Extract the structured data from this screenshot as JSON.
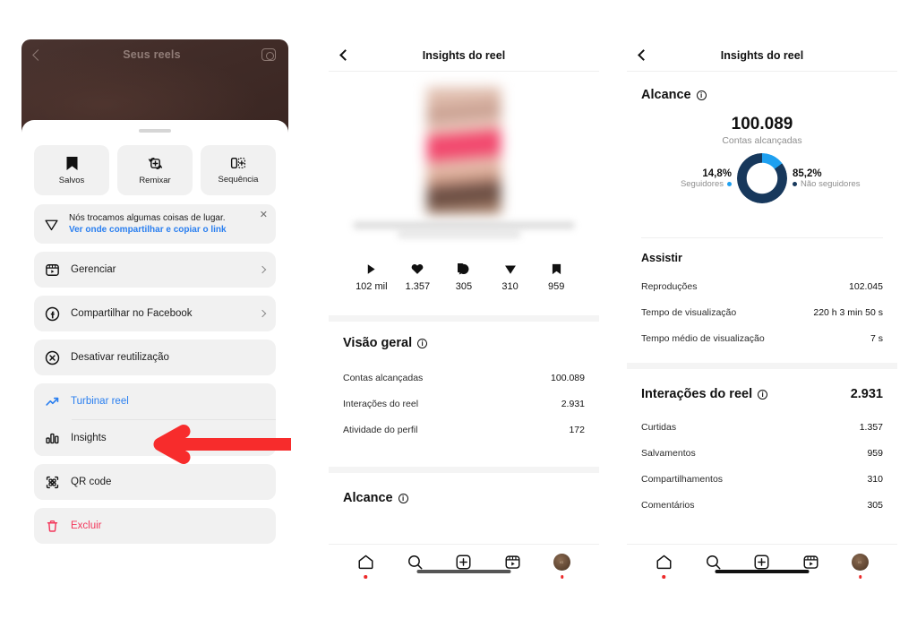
{
  "panel1": {
    "reel_header": {
      "title": "Seus reels",
      "back_icon": "chevron-left-icon",
      "camera_icon": "camera-icon"
    },
    "tiles": [
      {
        "label": "Salvos",
        "icon": "bookmark-icon"
      },
      {
        "label": "Remixar",
        "icon": "remix-icon"
      },
      {
        "label": "Sequência",
        "icon": "sequence-icon"
      }
    ],
    "banner": {
      "icon": "paper-plane-icon",
      "line1": "Nós trocamos algumas coisas de lugar.",
      "line2": "Ver onde compartilhar e copiar o link",
      "close_icon": "close-icon"
    },
    "rows": [
      {
        "label": "Gerenciar",
        "icon": "reels-icon",
        "chevron": true,
        "style": "default"
      },
      {
        "label": "Compartilhar no Facebook",
        "icon": "facebook-icon",
        "chevron": true,
        "style": "default"
      },
      {
        "label": "Desativar reutilização",
        "icon": "circle-x-icon",
        "chevron": false,
        "style": "default"
      }
    ],
    "group_rows": [
      {
        "label": "Turbinar reel",
        "icon": "trending-up-icon",
        "chevron": false,
        "style": "blue"
      },
      {
        "label": "Insights",
        "icon": "bar-chart-icon",
        "chevron": false,
        "style": "default"
      }
    ],
    "rows_after": [
      {
        "label": "QR code",
        "icon": "qr-code-icon",
        "chevron": false,
        "style": "default"
      },
      {
        "label": "Excluir",
        "icon": "trash-icon",
        "chevron": false,
        "style": "red"
      }
    ],
    "annotation": {
      "shape": "left-arrow",
      "color": "#F72C2C"
    }
  },
  "panel2": {
    "header": {
      "title": "Insights do reel",
      "back_icon": "chevron-left-icon"
    },
    "media_stats": [
      {
        "icon": "play-icon",
        "value": "102 mil"
      },
      {
        "icon": "heart-icon",
        "value": "1.357"
      },
      {
        "icon": "comment-icon",
        "value": "305"
      },
      {
        "icon": "share-icon",
        "value": "310"
      },
      {
        "icon": "bookmark-icon",
        "value": "959"
      }
    ],
    "overview": {
      "title": "Visão geral",
      "info_icon": "info-icon",
      "rows": [
        {
          "label": "Contas alcançadas",
          "value": "100.089"
        },
        {
          "label": "Interações do reel",
          "value": "2.931"
        },
        {
          "label": "Atividade do perfil",
          "value": "172"
        }
      ]
    },
    "reach": {
      "title": "Alcance",
      "info_icon": "info-icon"
    }
  },
  "panel3": {
    "header": {
      "title": "Insights do reel",
      "back_icon": "chevron-left-icon"
    },
    "reach": {
      "title": "Alcance",
      "info_icon": "info-icon",
      "total": "100.089",
      "total_label": "Contas alcançadas",
      "left_pct": "14,8%",
      "left_label": "Seguidores",
      "right_pct": "85,2%",
      "right_label": "Não seguidores"
    },
    "watch": {
      "title": "Assistir",
      "rows": [
        {
          "label": "Reproduções",
          "value": "102.045"
        },
        {
          "label": "Tempo de visualização",
          "value": "220 h 3 min 50 s"
        },
        {
          "label": "Tempo médio de visualização",
          "value": "7 s"
        }
      ]
    },
    "interactions": {
      "title": "Interações do reel",
      "info_icon": "info-icon",
      "total": "2.931",
      "rows": [
        {
          "label": "Curtidas",
          "value": "1.357"
        },
        {
          "label": "Salvamentos",
          "value": "959"
        },
        {
          "label": "Compartilhamentos",
          "value": "310"
        },
        {
          "label": "Comentários",
          "value": "305"
        }
      ]
    }
  },
  "navbar": {
    "items": [
      {
        "icon": "home-icon",
        "dot": true
      },
      {
        "icon": "search-icon",
        "dot": false
      },
      {
        "icon": "create-plus-icon",
        "dot": false
      },
      {
        "icon": "reels-icon",
        "dot": false
      },
      {
        "icon": "profile-avatar",
        "dot": true
      }
    ]
  },
  "chart_data": {
    "type": "pie",
    "title": "Alcance — Contas alcançadas",
    "categories": [
      "Seguidores",
      "Não seguidores"
    ],
    "values": [
      14.8,
      85.2
    ],
    "value_labels": [
      "14,8%",
      "85,2%"
    ],
    "total": 100089,
    "total_label": "Contas alcançadas",
    "colors": [
      "#1EA0F0",
      "#17385C"
    ],
    "legend_position": "sides",
    "donut": true
  },
  "colors": {
    "accent_blue": "#2a7ff0",
    "link_blue": "#2a7ff0",
    "danger_red": "#f3385c",
    "arrow_red": "#F72C2C",
    "donut_light": "#1EA0F0",
    "donut_dark": "#17385C",
    "tile_bg": "#f1f1f1",
    "muted_text": "#8e8e8e"
  }
}
